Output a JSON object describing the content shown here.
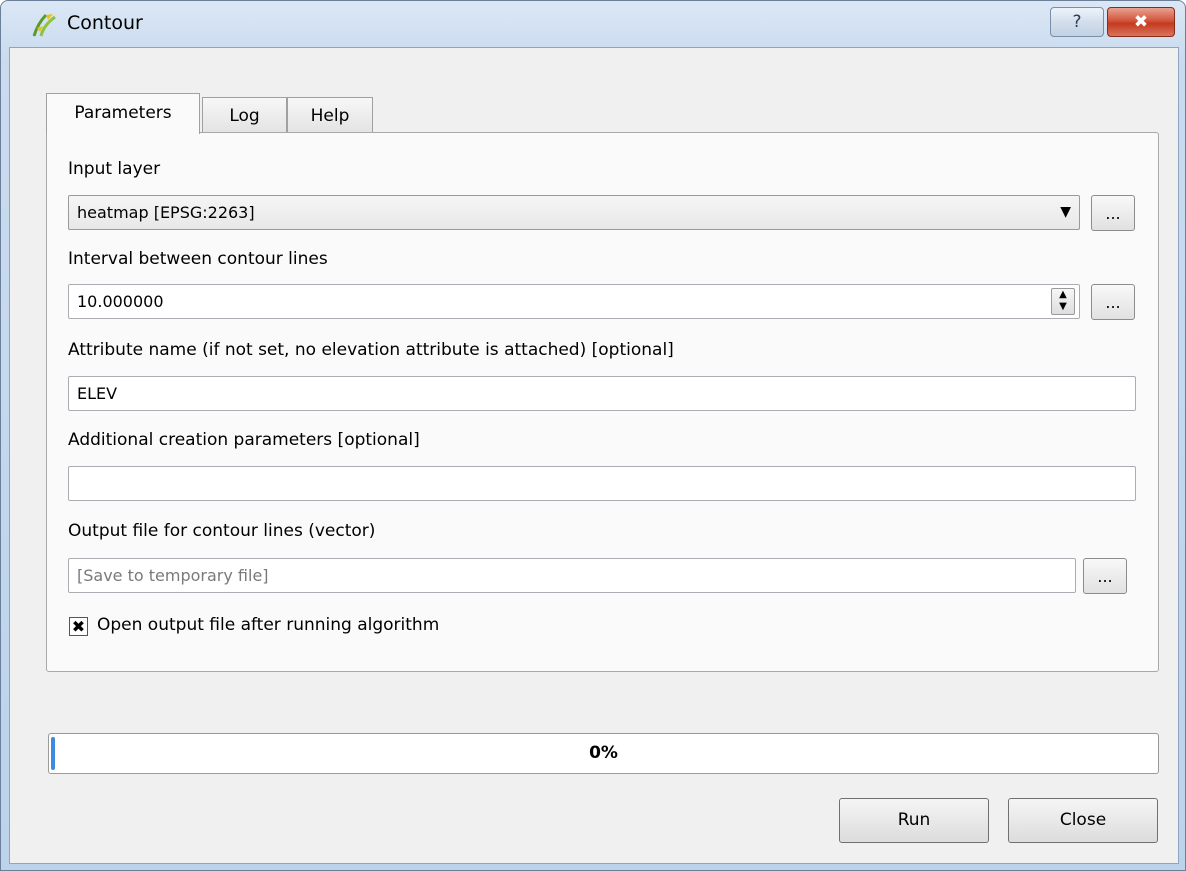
{
  "window": {
    "title": "Contour",
    "help_label": "?",
    "close_label": "✖"
  },
  "tabs": [
    {
      "label": "Parameters",
      "active": true
    },
    {
      "label": "Log",
      "active": false
    },
    {
      "label": "Help",
      "active": false
    }
  ],
  "form": {
    "input_layer": {
      "label": "Input layer",
      "value": "heatmap [EPSG:2263]",
      "arrow": "▼",
      "browse_label": "..."
    },
    "interval": {
      "label": "Interval between contour lines",
      "value": "10.000000",
      "spin_up": "▲",
      "spin_down": "▼",
      "browse_label": "..."
    },
    "attribute_name": {
      "label": "Attribute name (if not set, no elevation attribute is attached) [optional]",
      "value": "ELEV"
    },
    "additional_params": {
      "label": "Additional creation parameters [optional]",
      "value": ""
    },
    "output_file": {
      "label": "Output file for contour lines (vector)",
      "placeholder": "[Save to temporary file]",
      "browse_label": "..."
    },
    "open_output": {
      "label": "Open output file after running algorithm",
      "checked": true,
      "check_glyph": "✖"
    }
  },
  "progress": {
    "value": 0,
    "text": "0%",
    "color": "#3c8be0"
  },
  "buttons": {
    "run": "Run",
    "close": "Close"
  }
}
